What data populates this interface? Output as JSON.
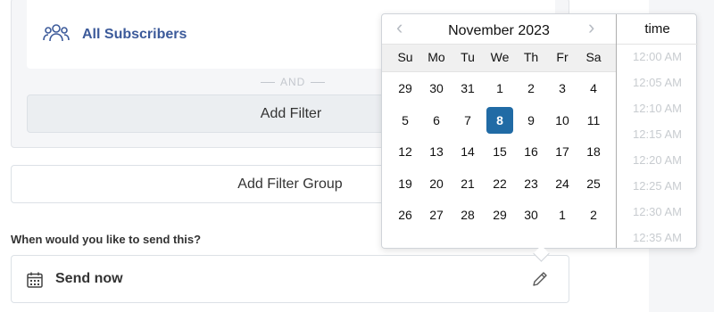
{
  "segment": {
    "subscribers_label": "All Subscribers",
    "and_label": "AND",
    "add_filter_label": "Add Filter",
    "add_filter_group_label": "Add Filter Group"
  },
  "schedule": {
    "question": "When would you like to send this?",
    "value": "Send now"
  },
  "datepicker": {
    "month_label": "November 2023",
    "weekdays": [
      "Su",
      "Mo",
      "Tu",
      "We",
      "Th",
      "Fr",
      "Sa"
    ],
    "weeks": [
      [
        "29",
        "30",
        "31",
        "1",
        "2",
        "3",
        "4"
      ],
      [
        "5",
        "6",
        "7",
        "8",
        "9",
        "10",
        "11"
      ],
      [
        "12",
        "13",
        "14",
        "15",
        "16",
        "17",
        "18"
      ],
      [
        "19",
        "20",
        "21",
        "22",
        "23",
        "24",
        "25"
      ],
      [
        "26",
        "27",
        "28",
        "29",
        "30",
        "1",
        "2"
      ]
    ],
    "selected_day": "8",
    "time_header": "time",
    "times": [
      "12:00 AM",
      "12:05 AM",
      "12:10 AM",
      "12:15 AM",
      "12:20 AM",
      "12:25 AM",
      "12:30 AM",
      "12:35 AM"
    ]
  },
  "colors": {
    "accent": "#216ba5",
    "link": "#3c5a9a"
  }
}
